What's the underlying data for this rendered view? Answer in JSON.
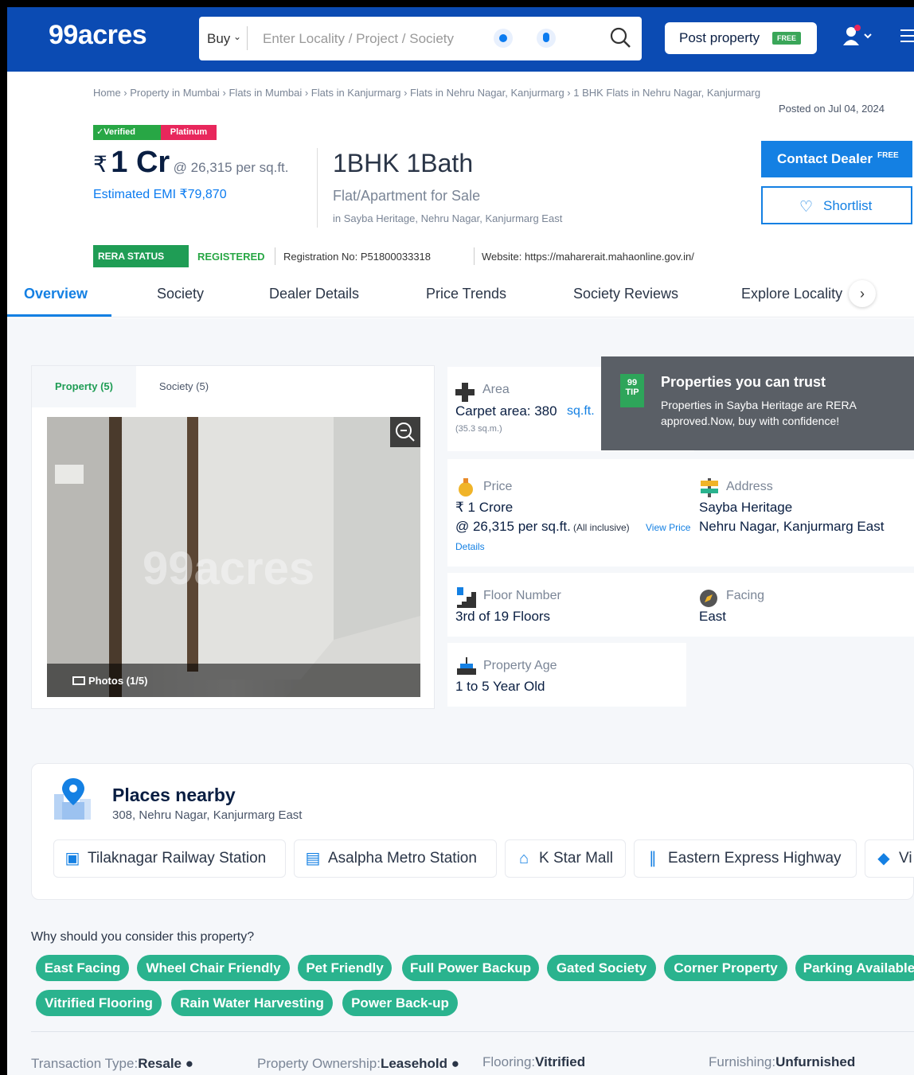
{
  "header": {
    "logo": "99acres",
    "buy_label": "Buy",
    "search_placeholder": "Enter Locality / Project / Society",
    "post_property": "Post property",
    "free_tag": "FREE"
  },
  "breadcrumb": "Home › Property in Mumbai › Flats in Mumbai › Flats in Kanjurmarg › Flats in Nehru Nagar, Kanjurmarg › 1 BHK Flats in Nehru Nagar, Kanjurmarg",
  "posted": "Posted on Jul 04, 2024",
  "badges": {
    "verified": "✓Verified",
    "platinum": "Platinum"
  },
  "price": {
    "rupee": "₹",
    "amount": "1 Cr",
    "per_sqft": "@ 26,315 per sq.ft.",
    "emi": "Estimated EMI ₹79,870"
  },
  "property": {
    "bhk": "1BHK 1Bath",
    "type": "Flat/Apartment for Sale",
    "location": "in Sayba Heritage, Nehru Nagar, Kanjurmarg East"
  },
  "actions": {
    "contact": "Contact Dealer",
    "contact_free": "FREE",
    "shortlist": "Shortlist"
  },
  "rera": {
    "status": "RERA STATUS",
    "registered": "REGISTERED",
    "reg_no": "Registration No: P51800033318",
    "website": "Website: https://maharerait.mahaonline.gov.in/"
  },
  "tabs": [
    "Overview",
    "Society",
    "Dealer Details",
    "Price Trends",
    "Society Reviews",
    "Explore Locality"
  ],
  "gallery": {
    "tab1": "Property (5)",
    "tab2": "Society (5)",
    "photos": "Photos (1/5)",
    "watermark": "99acres"
  },
  "details": {
    "area_label": "Area",
    "area_value": "Carpet area: 380",
    "area_unit": "sq.ft.",
    "area_sqm": "(35.3 sq.m.)",
    "price_label": "Price",
    "price_value": "₹ 1 Crore",
    "price_per": "@ 26,315 per sq.ft.",
    "price_incl": "(All inclusive)",
    "price_link": "View Price",
    "price_link2": "Details",
    "address_label": "Address",
    "address_line1": "Sayba Heritage",
    "address_line2": "Nehru Nagar, Kanjurmarg East",
    "floor_label": "Floor Number",
    "floor_value": "3rd  of 19 Floors",
    "facing_label": "Facing",
    "facing_value": "East",
    "age_label": "Property Age",
    "age_value": "1 to 5 Year Old"
  },
  "trust": {
    "title": "Properties you can trust",
    "desc": "Properties in Sayba Heritage are RERA approved.Now, buy with confidence!",
    "tip": "99 TIP"
  },
  "nearby": {
    "title": "Places nearby",
    "subtitle": "308, Nehru Nagar, Kanjurmarg East",
    "places": [
      "Tilaknagar Railway Station",
      "Asalpha Metro Station",
      "K Star Mall",
      "Eastern Express Highway",
      "Vi"
    ]
  },
  "why": {
    "title": "Why should you consider this property?",
    "features": [
      "East Facing",
      "Wheel Chair Friendly",
      "Pet Friendly",
      "Full Power Backup",
      "Gated Society",
      "Corner Property",
      "Parking Available",
      "Vitrified Flooring",
      "Rain Water Harvesting",
      "Power Back-up"
    ]
  },
  "bottom": {
    "transaction_label": "Transaction Type:",
    "transaction_value": "Resale",
    "ownership_label": "Property Ownership:",
    "ownership_value": "Leasehold",
    "flooring_label": "Flooring:",
    "flooring_value": "Vitrified",
    "furnishing_label": "Furnishing:",
    "furnishing_value": "Unfurnished"
  },
  "colors": {
    "brand": "#0b4bb3",
    "accent": "#1480e3",
    "feature": "#2ab38e",
    "rera": "#1f9d55"
  }
}
